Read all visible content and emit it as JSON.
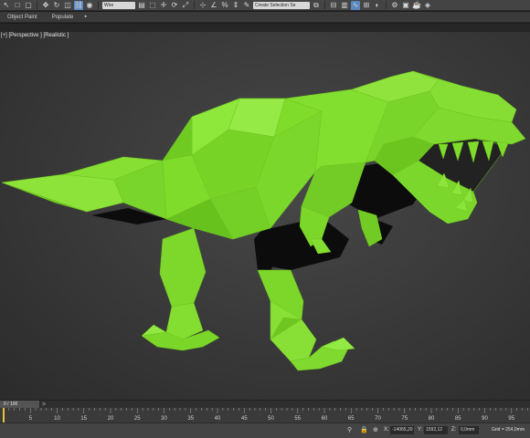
{
  "toolbar": {
    "selection_filter": "Wire",
    "named_selection": "Create Selection Se"
  },
  "ribbon": {
    "tabs": [
      "Object Paint",
      "Populate"
    ],
    "extra_glyph": "▪"
  },
  "viewport": {
    "label": "[+] [Perspective ] [Realistic ]",
    "model_name": "Low-poly T-Rex",
    "model_color": "#7fdc2a",
    "model_shadow_color": "#0c0c0c"
  },
  "timeslider": {
    "frame": "0 / 100",
    "arrow": ">"
  },
  "trackbar": {
    "ticks": [
      "5",
      "10",
      "15",
      "20",
      "25",
      "30",
      "35",
      "40",
      "45",
      "50",
      "55",
      "60",
      "65",
      "70",
      "75",
      "80",
      "85",
      "90",
      "95"
    ]
  },
  "status": {
    "x_label": "X:",
    "x_value": "-14065,20",
    "y_label": "Y:",
    "y_value": "1592,12",
    "z_label": "Z:",
    "z_value": "0,0mm",
    "grid": "Grid = 254,0mm"
  },
  "colors": {
    "ui_dark": "#444444",
    "viewport_bg": "#3b3b3b",
    "accent_blue": "#5a87c0",
    "dino_green": "#7fdc2a"
  }
}
